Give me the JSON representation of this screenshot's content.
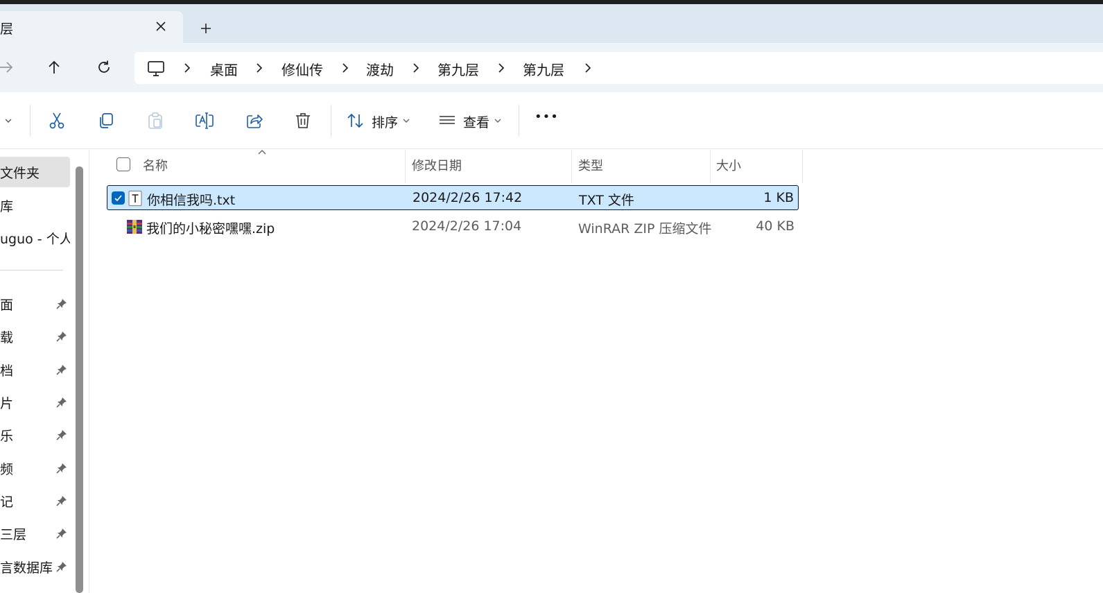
{
  "window": {
    "tab_title": "层",
    "close_glyph": "✕",
    "new_tab_glyph": "+"
  },
  "breadcrumb": {
    "items": [
      "桌面",
      "修仙传",
      "渡劫",
      "第九层",
      "第九层"
    ]
  },
  "toolbar": {
    "sort_label": "排序",
    "view_label": "查看",
    "more_glyph": "•••"
  },
  "sidebar": {
    "top_items": [
      {
        "label": "文件夹",
        "selected": true
      },
      {
        "label": "库",
        "selected": false
      },
      {
        "label": "uguo - 个人",
        "selected": false
      }
    ],
    "pinned_items": [
      "面",
      "载",
      "档",
      "片",
      "乐",
      "频",
      "记",
      "三层",
      "言数据库"
    ]
  },
  "columns": {
    "name": "名称",
    "modified": "修改日期",
    "type": "类型",
    "size": "大小"
  },
  "files": [
    {
      "name": "你相信我吗.txt",
      "modified": "2024/2/26 17:42",
      "type": "TXT 文件",
      "size": "1 KB",
      "selected": true,
      "icon": "text-file-icon"
    },
    {
      "name": "我们的小秘密嘿嘿.zip",
      "modified": "2024/2/26 17:04",
      "type": "WinRAR ZIP 压缩文件",
      "size": "40 KB",
      "selected": false,
      "icon": "winrar-archive-icon"
    }
  ],
  "colors": {
    "accent": "#0067c0",
    "selection": "#cce8ff",
    "chrome": "#eef3f8",
    "tabbar": "#dde7f1"
  }
}
